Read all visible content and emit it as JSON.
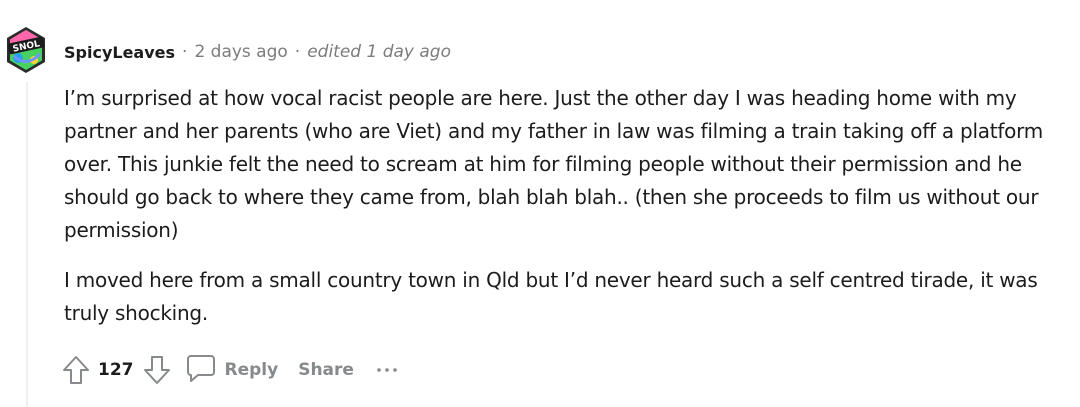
{
  "comment": {
    "author": "SpicyLeaves",
    "separator": "·",
    "timestamp": "2 days ago",
    "edited": "edited 1 day ago",
    "avatar_icon": "snoo-avatar-icon",
    "paragraphs": [
      "I’m surprised at how vocal racist people are here. Just the other day I was heading home with my partner and her parents (who are Viet) and my father in law was filming a train taking off a platform over. This junkie felt the need to scream at him for filming people without their permission and he should go back to where they came from, blah blah blah.. (then she proceeds to film us without our permission)",
      "I moved here from a small country town in Qld but I’d never heard such a self centred tirade, it was truly shocking."
    ]
  },
  "actions": {
    "upvote_icon": "upvote-arrow-icon",
    "score": "127",
    "downvote_icon": "downvote-arrow-icon",
    "reply_icon": "speech-bubble-icon",
    "reply_label": "Reply",
    "share_label": "Share",
    "more_icon": "more-options-icon"
  },
  "colors": {
    "text": "#1c1c1c",
    "meta": "#7c7c7c",
    "action": "#878a8c",
    "thread_line": "#edeff1"
  }
}
